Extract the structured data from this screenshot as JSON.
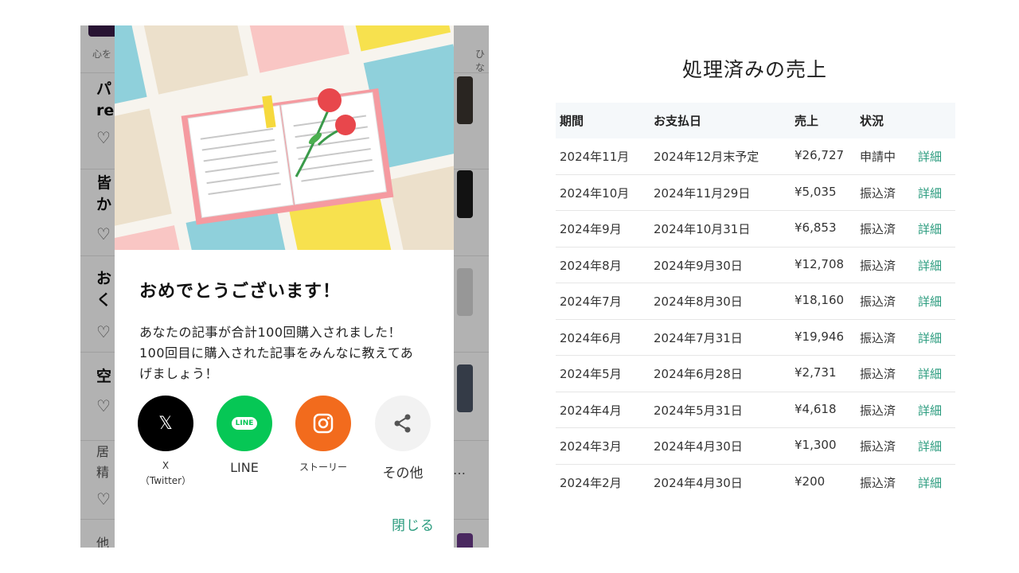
{
  "background_feed": {
    "tags": [
      "心を",
      "ひな"
    ],
    "rows": [
      {
        "title": "パ",
        "title2": "reg"
      },
      {
        "title": "皆",
        "title2": "か"
      },
      {
        "title": "お",
        "title2": "く"
      },
      {
        "title": "空"
      },
      {
        "sub": "居",
        "sub2": "精",
        "ellipsis": "…"
      },
      {
        "sub": "他"
      }
    ]
  },
  "modal": {
    "title": "おめでとうございます！",
    "body_lines": [
      "あなたの記事が合計100回購入されました！",
      "100回目に購入された記事をみんなに教えてあ",
      "げましょう！"
    ],
    "share": [
      {
        "name": "x",
        "label1": "X",
        "label2": "（Twitter）",
        "color": "#000000"
      },
      {
        "name": "line",
        "label1": "LINE",
        "color": "#06c755",
        "glyph": "LINE"
      },
      {
        "name": "story",
        "label1": "ストーリー",
        "color": "#f26b1d"
      },
      {
        "name": "other",
        "label1": "その他",
        "color": "#f2f2f2"
      }
    ],
    "close_label": "閉じる"
  },
  "sales": {
    "title": "処理済みの売上",
    "headers": [
      "期間",
      "お支払日",
      "売上",
      "状況"
    ],
    "rows": [
      {
        "period": "2024年11月",
        "paid": "2024年12月末予定",
        "amount": "¥26,727",
        "status": "申請中",
        "link": "詳細"
      },
      {
        "period": "2024年10月",
        "paid": "2024年11月29日",
        "amount": "¥5,035",
        "status": "振込済",
        "link": "詳細"
      },
      {
        "period": "2024年9月",
        "paid": "2024年10月31日",
        "amount": "¥6,853",
        "status": "振込済",
        "link": "詳細"
      },
      {
        "period": "2024年8月",
        "paid": "2024年9月30日",
        "amount": "¥12,708",
        "status": "振込済",
        "link": "詳細"
      },
      {
        "period": "2024年7月",
        "paid": "2024年8月30日",
        "amount": "¥18,160",
        "status": "振込済",
        "link": "詳細"
      },
      {
        "period": "2024年6月",
        "paid": "2024年7月31日",
        "amount": "¥19,946",
        "status": "振込済",
        "link": "詳細"
      },
      {
        "period": "2024年5月",
        "paid": "2024年6月28日",
        "amount": "¥2,731",
        "status": "振込済",
        "link": "詳細"
      },
      {
        "period": "2024年4月",
        "paid": "2024年5月31日",
        "amount": "¥4,618",
        "status": "振込済",
        "link": "詳細"
      },
      {
        "period": "2024年3月",
        "paid": "2024年4月30日",
        "amount": "¥1,300",
        "status": "振込済",
        "link": "詳細"
      },
      {
        "period": "2024年2月",
        "paid": "2024年4月30日",
        "amount": "¥200",
        "status": "振込済",
        "link": "詳細"
      }
    ]
  },
  "colors": {
    "accent": "#2c9c7f",
    "x": "#000000",
    "line": "#06c755",
    "instagram": "#f26b1d"
  }
}
